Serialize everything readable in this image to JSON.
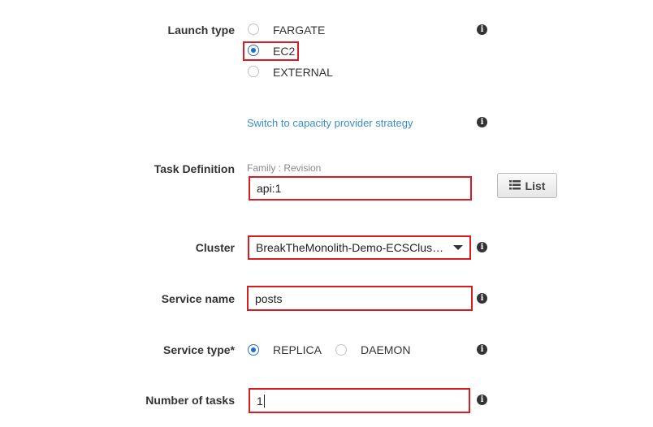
{
  "launch_type": {
    "label": "Launch type",
    "options": [
      {
        "label": "FARGATE",
        "selected": false
      },
      {
        "label": "EC2",
        "selected": true
      },
      {
        "label": "EXTERNAL",
        "selected": false
      }
    ],
    "info_icon": "info-icon"
  },
  "capacity_link": {
    "label": "Switch to capacity provider strategy"
  },
  "task_definition": {
    "label": "Task Definition",
    "hint": "Family : Revision",
    "value": "api:1",
    "list_button": "List"
  },
  "cluster": {
    "label": "Cluster",
    "value": "BreakTheMonolith-Demo-ECSClus…"
  },
  "service_name": {
    "label": "Service name",
    "value": "posts"
  },
  "service_type": {
    "label": "Service type*",
    "options": [
      {
        "label": "REPLICA",
        "selected": true
      },
      {
        "label": "DAEMON",
        "selected": false
      }
    ]
  },
  "number_of_tasks": {
    "label": "Number of tasks",
    "value": "1"
  },
  "colors": {
    "highlight": "#d91c24",
    "link": "#3a8fc8",
    "radio_selected": "#1a6fd3"
  }
}
